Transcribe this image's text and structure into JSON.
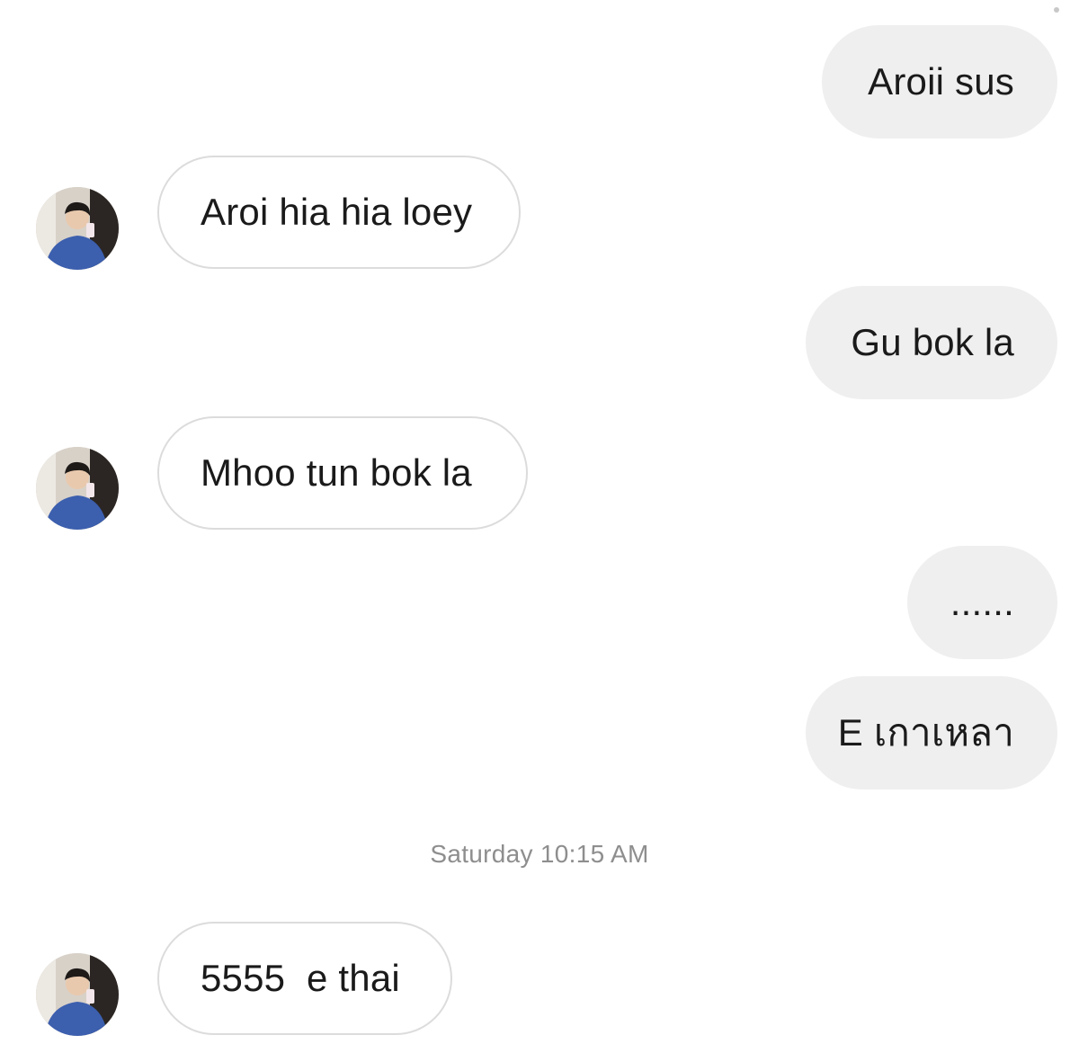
{
  "messages": [
    {
      "id": "m1",
      "direction": "outgoing",
      "text": "Aroii sus"
    },
    {
      "id": "m2",
      "direction": "incoming",
      "text": "Aroi hia hia loey"
    },
    {
      "id": "m3",
      "direction": "outgoing",
      "text": "Gu bok la"
    },
    {
      "id": "m4",
      "direction": "incoming",
      "text": "Mhoo tun bok la"
    },
    {
      "id": "m5",
      "direction": "outgoing",
      "text": "......"
    },
    {
      "id": "m6",
      "direction": "outgoing",
      "text": "E เกาเหลา"
    },
    {
      "id": "m7",
      "direction": "incoming",
      "text": "5555  e thai"
    }
  ],
  "timestamp": "Saturday 10:15 AM",
  "colors": {
    "outgoing_bubble": "#efefef",
    "incoming_border": "#dcdcdc",
    "timestamp_text": "#8e8e8e"
  },
  "icons": {
    "avatar": "profile-photo-icon"
  }
}
